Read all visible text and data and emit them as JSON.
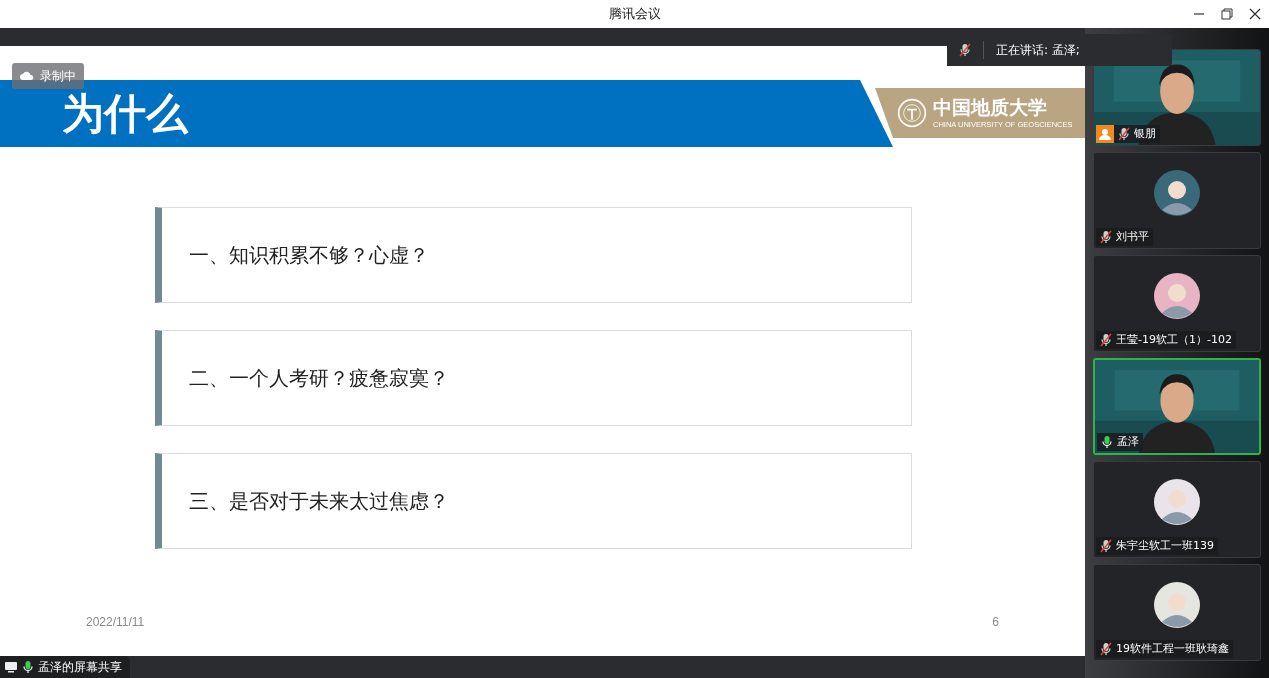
{
  "window": {
    "title": "腾讯会议"
  },
  "recording": {
    "label": "录制中"
  },
  "speaking": {
    "label": "正在讲话: 孟泽;",
    "muted": true
  },
  "slide": {
    "title": "为什么",
    "logo": {
      "name": "中国地质大学",
      "subtitle": "CHINA UNIVERSITY OF GEOSCIENCES"
    },
    "items": [
      "一、知识积累不够？心虚？",
      "二、一个人考研？疲惫寂寞？",
      "三、是否对于未来太过焦虑？"
    ],
    "date": "2022/11/11",
    "page": "6"
  },
  "participants": [
    {
      "name": "银朋",
      "kind": "video",
      "muted": true,
      "speaking": false,
      "host": true
    },
    {
      "name": "刘书平",
      "kind": "avatar",
      "muted": true,
      "speaking": false,
      "host": false
    },
    {
      "name": "王莹-19软工（1）-102",
      "kind": "avatar",
      "muted": true,
      "speaking": false,
      "host": false
    },
    {
      "name": "孟泽",
      "kind": "video",
      "muted": false,
      "speaking": true,
      "host": false
    },
    {
      "name": "朱宇尘软工一班139",
      "kind": "avatar",
      "muted": true,
      "speaking": false,
      "host": false
    },
    {
      "name": "19软件工程一班耿琦鑫",
      "kind": "avatar",
      "muted": true,
      "speaking": false,
      "host": false
    }
  ],
  "share": {
    "label": "孟泽的屏幕共享",
    "muted": false
  }
}
